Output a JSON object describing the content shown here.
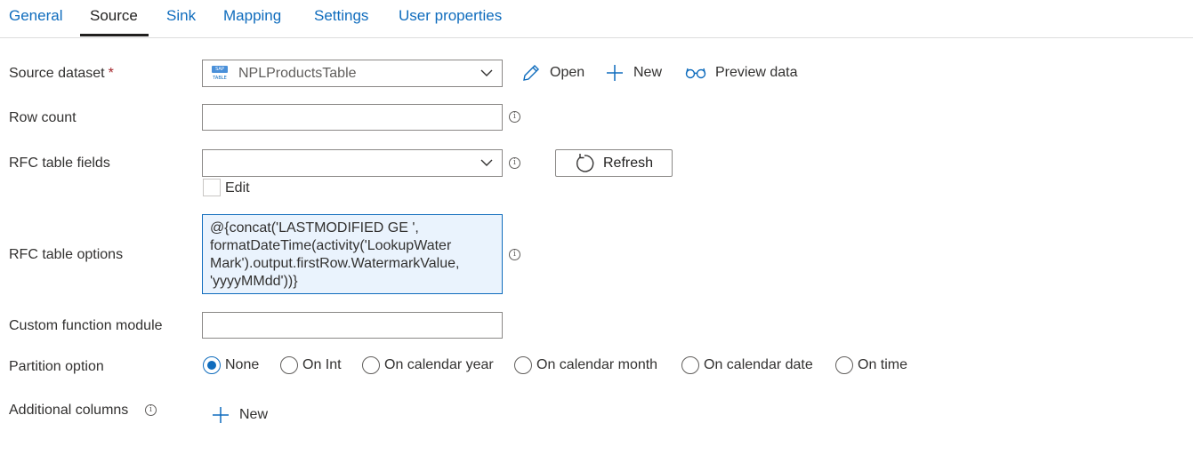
{
  "tabs": [
    "General",
    "Source",
    "Sink",
    "Mapping",
    "Settings",
    "User properties"
  ],
  "active_tab": "Source",
  "source_dataset": {
    "label": "Source dataset",
    "required_mark": "*",
    "badge_top": "SAP",
    "badge_bottom": "TABLE",
    "value": "NPLProductsTable",
    "open_label": "Open",
    "new_label": "New",
    "preview_label": "Preview data"
  },
  "row_count": {
    "label": "Row count",
    "value": ""
  },
  "rfc_table_fields": {
    "label": "RFC table fields",
    "value": "",
    "edit_label": "Edit",
    "refresh_label": "Refresh"
  },
  "rfc_table_options": {
    "label": "RFC table options",
    "value": "@{concat('LASTMODIFIED GE ', formatDateTime(activity('LookupWater Mark').output.firstRow.WatermarkValue, 'yyyyMMdd'))}"
  },
  "custom_function_module": {
    "label": "Custom function module",
    "value": ""
  },
  "partition_option": {
    "label": "Partition option",
    "options": [
      "None",
      "On Int",
      "On calendar year",
      "On calendar month",
      "On calendar date",
      "On time"
    ],
    "selected": "None"
  },
  "additional_columns": {
    "label": "Additional columns",
    "new_label": "New"
  },
  "colors": {
    "accent": "#0f6cbd",
    "required": "#a4262c",
    "text": "#323130",
    "textarea_bg": "#eaf3fd"
  },
  "icons": {
    "dataset": "sap-table-icon",
    "open": "pencil-icon",
    "new": "plus-icon",
    "preview": "glasses-icon",
    "refresh": "refresh-icon",
    "chevron": "chevron-down-icon",
    "info": "info-icon"
  }
}
